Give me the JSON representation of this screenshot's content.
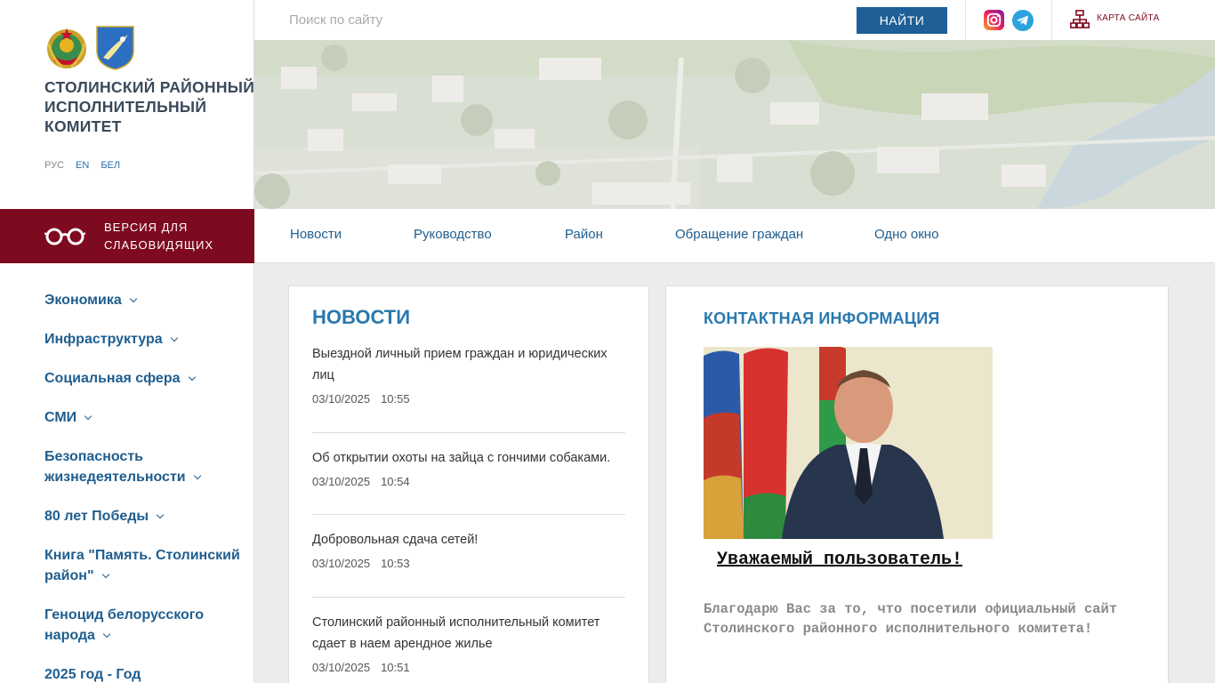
{
  "header": {
    "org_title": "Столинский районный исполнительный комитет",
    "languages": [
      {
        "label": "РУС",
        "active": true
      },
      {
        "label": "EN",
        "active": false
      },
      {
        "label": "БЕЛ",
        "active": false
      }
    ]
  },
  "accessibility": {
    "label": "Версия для слабовидящих"
  },
  "search": {
    "placeholder": "Поиск по сайту",
    "value": "",
    "button_label": "Найти"
  },
  "social": {
    "icons": [
      "instagram-icon",
      "telegram-icon"
    ]
  },
  "sitemap": {
    "label": "Карта сайта"
  },
  "top_nav": {
    "items": [
      "Новости",
      "Руководство",
      "Район",
      "Обращение граждан",
      "Одно окно"
    ]
  },
  "side_menu": {
    "items": [
      "Экономика",
      "Инфраструктура",
      "Социальная сфера",
      "СМИ",
      "Безопасность жизнедеятельности",
      "80 лет Победы",
      "Книга \"Память. Столинский район\"",
      "Геноцид белорусского народа",
      "2025 год - Год"
    ]
  },
  "news": {
    "title": "Новости",
    "items": [
      {
        "title": "Выездной личный прием граждан и юридических лиц",
        "date": "03/10/2025",
        "time": "10:55"
      },
      {
        "title": "Об открытии охоты на зайца с гончими собаками.",
        "date": "03/10/2025",
        "time": "10:54"
      },
      {
        "title": "Добровольная сдача сетей!",
        "date": "03/10/2025",
        "time": "10:53"
      },
      {
        "title": "Столинский районный исполнительный комитет сдает в наем арендное жилье",
        "date": "03/10/2025",
        "time": "10:51"
      }
    ]
  },
  "contacts": {
    "title": "Контактная информация",
    "greeting": "Уважаемый пользователь!",
    "message": "Благодарю Вас за то, что посетили официальный сайт Столинского районного исполнительного комитета!"
  },
  "colors": {
    "brand_dark_red": "#7e0a1f",
    "link_blue": "#1f5e8f",
    "heading_blue": "#2a78b0",
    "button_blue": "#1d5f96"
  }
}
